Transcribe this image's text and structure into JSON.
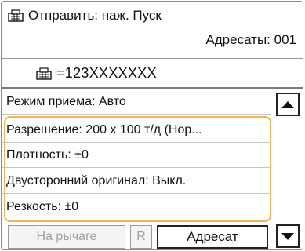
{
  "header": {
    "status": "Отправить: наж. Пуск",
    "destinations": "Адресаты: 001",
    "icon": "fax-icon"
  },
  "number": {
    "value": "=123XXXXXXX",
    "icon": "fax-icon"
  },
  "settings": {
    "items": [
      {
        "label": "Режим приема: Авто"
      },
      {
        "label": "Разрешение: 200 x 100 т/д (Нор..."
      },
      {
        "label": "Плотность: ±0"
      },
      {
        "label": "Двусторонний оригинал: Выкл."
      },
      {
        "label": "Резкость: ±0"
      }
    ]
  },
  "footer": {
    "on_hook": "На рычаге",
    "r": "R",
    "destination": "Адресат"
  },
  "colors": {
    "selection_border": "#f0b558",
    "border": "#8c8c8c"
  }
}
